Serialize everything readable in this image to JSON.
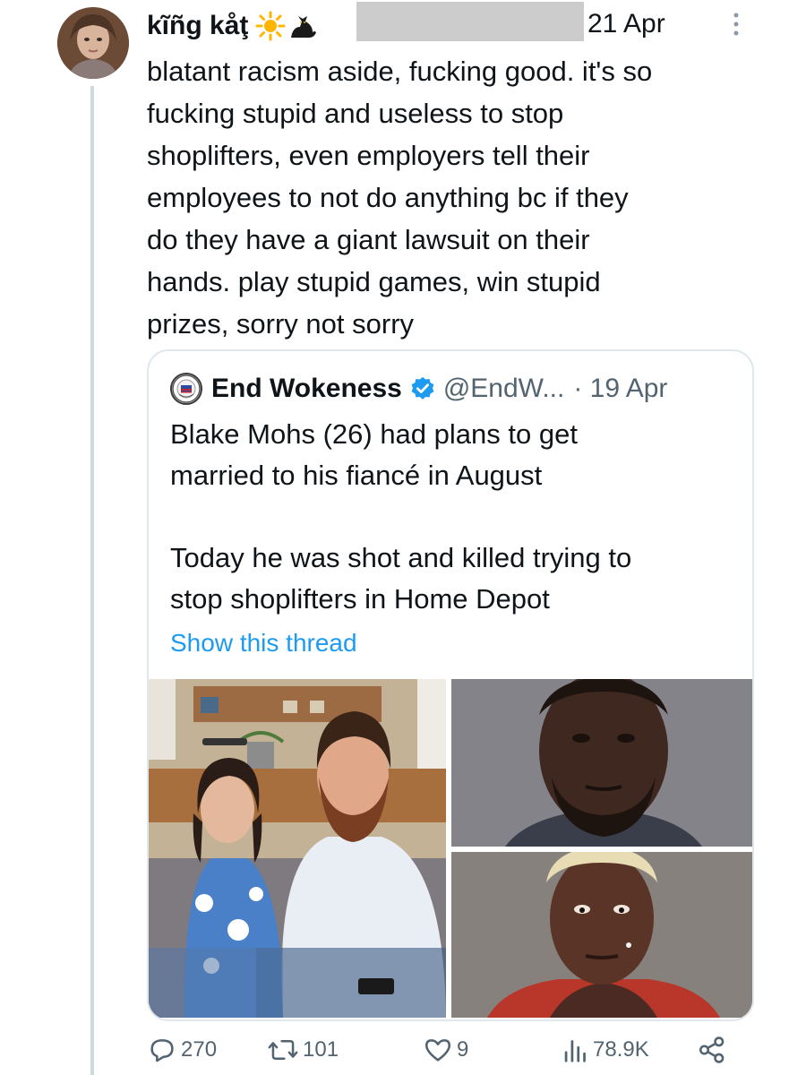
{
  "tweet": {
    "display_name": "kĩñg kåţ",
    "date": "21 Apr",
    "text": "blatant racism aside, fucking good. it's so\nfucking stupid and useless to stop\nshoplifters, even employers tell their\nemployees to not do anything bc if they\ndo they have a giant lawsuit on their\nhands. play stupid games, win stupid\nprizes, sorry not sorry",
    "name_emoji": [
      "sun-icon",
      "black-cat-icon"
    ],
    "stats": {
      "replies": "270",
      "retweets": "101",
      "likes": "9",
      "views": "78.9K"
    }
  },
  "quoted_tweet": {
    "name": "End Wokeness",
    "handle": "@EndW...",
    "date": "· 19 Apr",
    "text": "Blake Mohs (26) had plans to get\nmarried to his fiancé in August\n\nToday he was shot and killed trying to\nstop shoplifters in Home Depot",
    "show_thread_label": "Show this thread",
    "verified": true,
    "photos": [
      "couple-photo",
      "mugshot-man",
      "mugshot-woman"
    ]
  },
  "colors": {
    "text": "#0f1419",
    "secondary": "#536471",
    "link": "#1d9bf0",
    "verified": "#1d9bf0",
    "border": "#e1e8ed",
    "thread_line": "#cfd9de"
  }
}
